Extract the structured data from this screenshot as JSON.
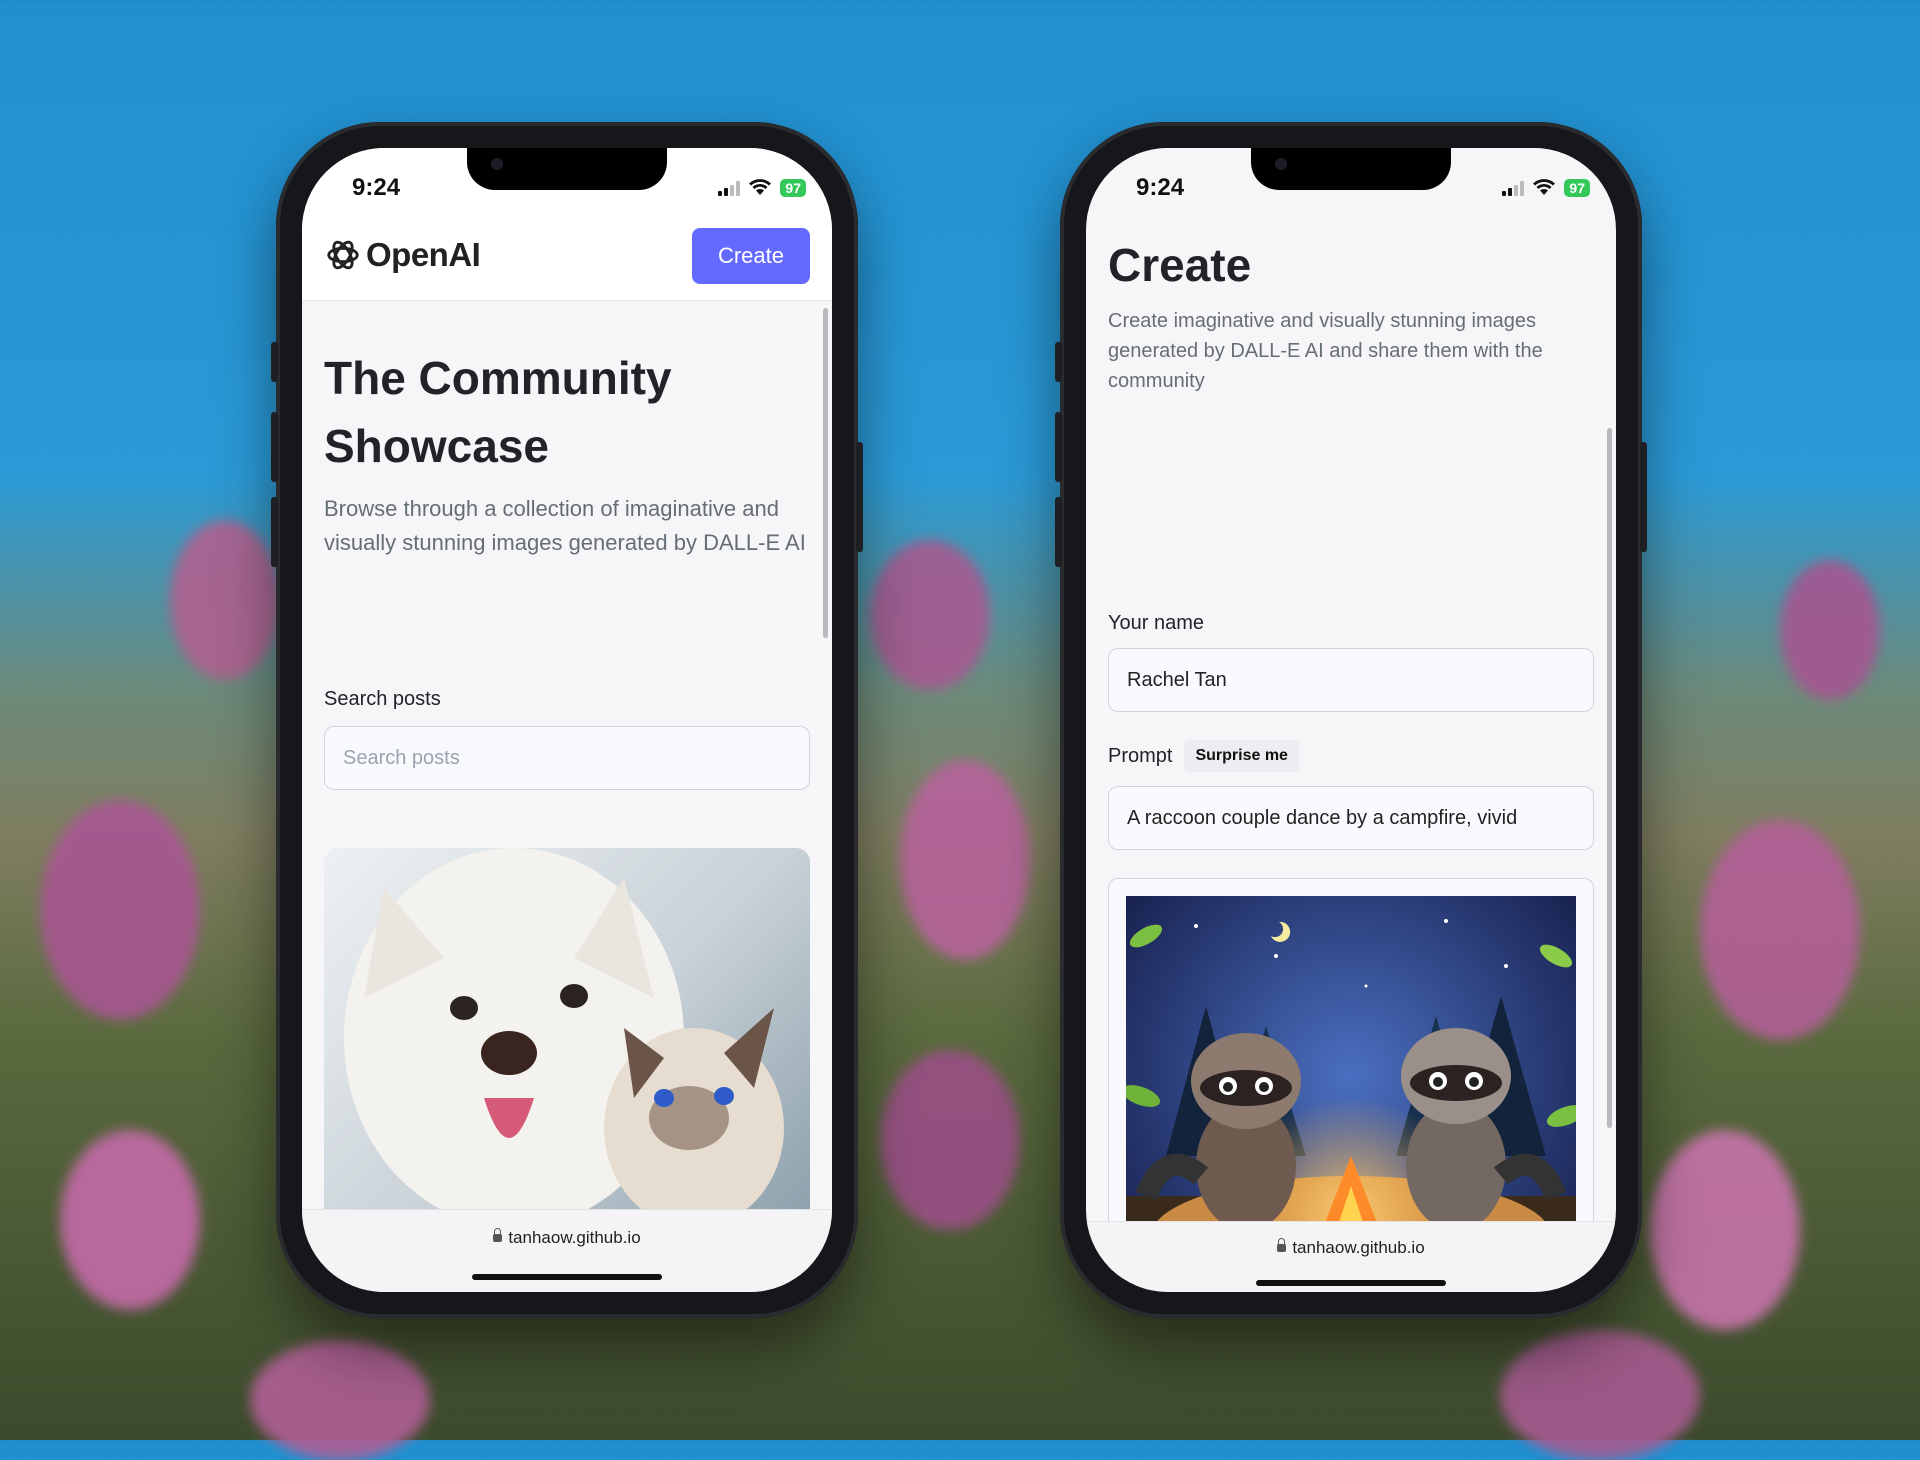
{
  "status_bar": {
    "time": "9:24",
    "battery": "97"
  },
  "left_screen": {
    "logo_text": "OpenAI",
    "create_button": "Create",
    "title_line1": "The Community",
    "title_line2": "Showcase",
    "description": "Browse through a collection of imaginative and visually stunning images generated by DALL-E AI",
    "search_label": "Search posts",
    "search_placeholder": "Search posts",
    "post_image_icon": "dog-and-cat-photo",
    "url": "tanhaow.github.io"
  },
  "right_screen": {
    "title": "Create",
    "description": "Create imaginative and visually stunning images generated by DALL-E AI and share them with the community",
    "name_label": "Your name",
    "name_value": "Rachel Tan",
    "prompt_label": "Prompt",
    "surprise_button": "Surprise me",
    "prompt_value": "A raccoon couple dance by a campfire, vivid",
    "generated_image_icon": "raccoons-campfire-illustration",
    "url": "tanhaow.github.io"
  },
  "colors": {
    "accent": "#6469ff",
    "battery": "#34c759",
    "background": "#f6f6f9"
  }
}
